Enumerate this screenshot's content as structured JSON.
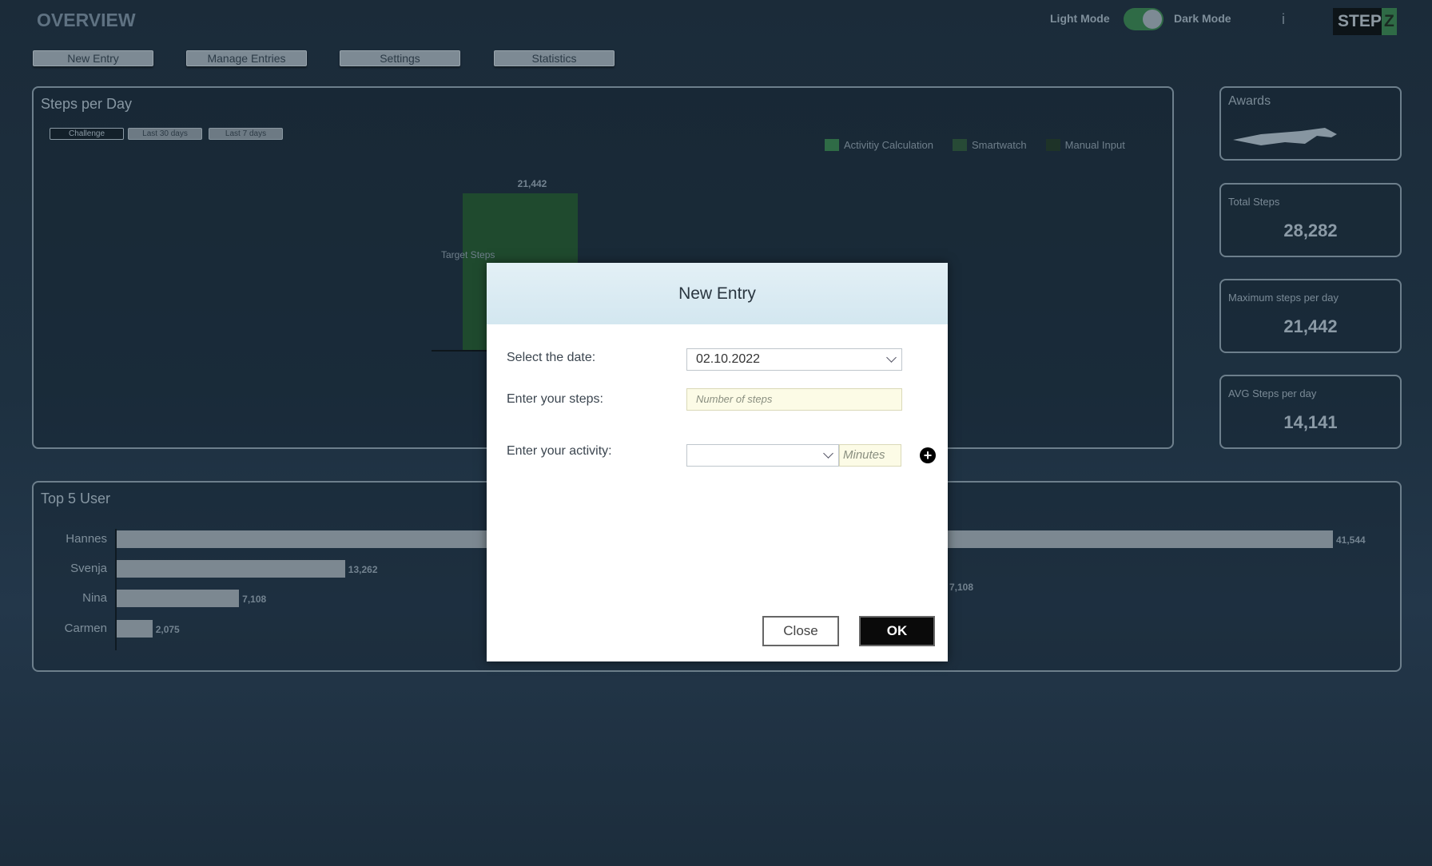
{
  "header": {
    "title": "OVERVIEW",
    "light_mode_label": "Light Mode",
    "dark_mode_label": "Dark Mode",
    "dark_mode_on": true,
    "info_icon": "i",
    "logo_text": "STEP",
    "logo_accent": "Z"
  },
  "nav": [
    "New Entry",
    "Manage Entries",
    "Settings",
    "Statistics"
  ],
  "steps_panel": {
    "title": "Steps per Day",
    "filters": [
      "Challenge",
      "Last 30 days",
      "Last 7 days"
    ],
    "active_filter": "Challenge",
    "legend": [
      {
        "label": "Activitiy Calculation",
        "color": "#2f6b46"
      },
      {
        "label": "Smartwatch",
        "color": "#274a36"
      },
      {
        "label": "Manual Input",
        "color": "#1e3328"
      }
    ],
    "target_label": "Target Steps"
  },
  "chart_data": [
    {
      "type": "bar",
      "title": "Steps per Day",
      "series": [
        {
          "name": "Activitiy Calculation",
          "values": [
            21442
          ]
        }
      ],
      "data_labels": [
        "21,442"
      ],
      "annotations": [
        "Target Steps"
      ]
    },
    {
      "type": "bar",
      "orientation": "horizontal",
      "title": "Top 5 User",
      "categories": [
        "Hannes",
        "Svenja",
        "Nina",
        "Carmen"
      ],
      "values": [
        41544,
        13262,
        7108,
        2075
      ],
      "data_labels": [
        "41,544",
        "13,262",
        "7,108",
        "2,075"
      ]
    }
  ],
  "cards": [
    {
      "label": "Awards"
    },
    {
      "label": "Total Steps",
      "value": "28,282"
    },
    {
      "label": "Maximum steps per day",
      "value": "21,442"
    },
    {
      "label": "AVG Steps per day",
      "value": "14,141"
    }
  ],
  "top_users": {
    "title": "Top 5 User",
    "secondary_label": "7,108"
  },
  "dialog": {
    "title": "New Entry",
    "date_label": "Select the date:",
    "date_value": "02.10.2022",
    "steps_label": "Enter your steps:",
    "steps_placeholder": "Number of steps",
    "activity_label": "Enter your activity:",
    "activity_value": "",
    "minutes_placeholder": "Minutes",
    "close_label": "Close",
    "ok_label": "OK"
  }
}
